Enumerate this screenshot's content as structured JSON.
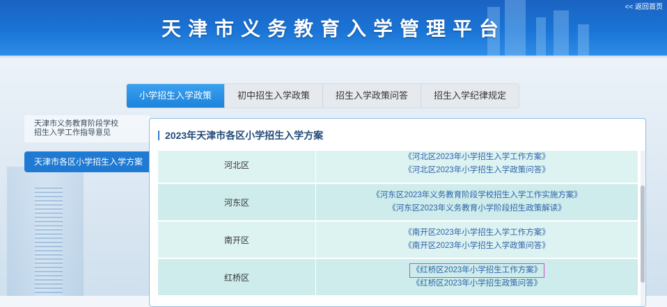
{
  "header": {
    "title": "天津市义务教育入学管理平台",
    "back_link": "<< 返回首页"
  },
  "tabs": [
    {
      "label": "小学招生入学政策",
      "active": true
    },
    {
      "label": "初中招生入学政策",
      "active": false
    },
    {
      "label": "招生入学政策问答",
      "active": false
    },
    {
      "label": "招生入学纪律规定",
      "active": false
    }
  ],
  "sidebar": {
    "items": [
      {
        "label_line1": "天津市义务教育阶段学校",
        "label_line2": "招生入学工作指导意见",
        "active": false
      },
      {
        "label": "天津市各区小学招生入学方案",
        "active": true
      }
    ]
  },
  "panel": {
    "title": "2023年天津市各区小学招生入学方案",
    "rows": [
      {
        "district": "河北区",
        "links": [
          "《河北区2023年小学招生入学工作方案》",
          "《河北区2023年小学招生入学政策问答》"
        ]
      },
      {
        "district": "河东区",
        "links": [
          "《河东区2023年义务教育阶段学校招生入学工作实施方案》",
          "《河东区2023年义务教育小学阶段招生政策解读》"
        ]
      },
      {
        "district": "南开区",
        "links": [
          "《南开区2023年小学招生入学工作方案》",
          "《南开区2023年小学招生入学政策问答》"
        ]
      },
      {
        "district": "红桥区",
        "links": [
          "《红桥区2023年小学招生工作方案》",
          "《红桥区2023年小学招生政策问答》"
        ]
      }
    ]
  },
  "colors": {
    "header_blue": "#1a74d6",
    "tab_active": "#1d83db",
    "sidebar_active": "#1f7ad3",
    "link_blue": "#2f63a8",
    "highlight_outline": "#c84ec4"
  }
}
